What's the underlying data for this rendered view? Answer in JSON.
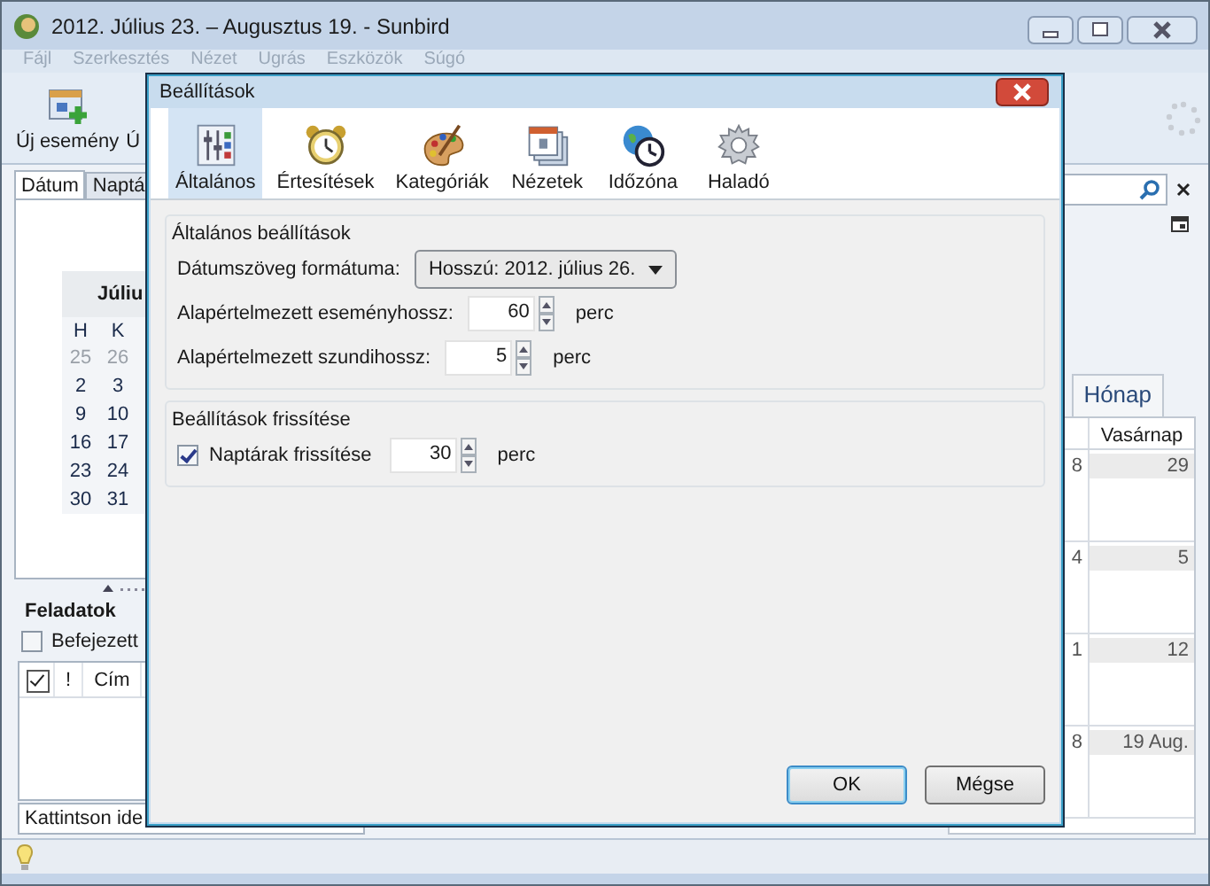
{
  "window": {
    "title": "2012. Július 23. – Augusztus 19. - Sunbird"
  },
  "menu": [
    {
      "label": "Fájl",
      "disabled": true
    },
    {
      "label": "Szerkesztés",
      "disabled": true
    },
    {
      "label": "Nézet",
      "disabled": true
    },
    {
      "label": "Ugrás",
      "disabled": true
    },
    {
      "label": "Eszközök",
      "disabled": true
    },
    {
      "label": "Súgó",
      "disabled": true
    }
  ],
  "toolbar": [
    {
      "label": "Új esemény",
      "kind": "event"
    },
    {
      "label": "Ú",
      "kind": "text"
    }
  ],
  "left_tabs": [
    {
      "label": "Dátum",
      "selected": true
    },
    {
      "label": "Naptá",
      "selected": false
    }
  ],
  "minimonth": {
    "title": "Júliu",
    "weekdays": [
      "H",
      "K"
    ],
    "weeks": [
      [
        {
          "text": "25",
          "outside": true
        },
        {
          "text": "26",
          "outside": true
        }
      ],
      [
        {
          "text": "2",
          "outside": false
        },
        {
          "text": "3",
          "outside": false
        }
      ],
      [
        {
          "text": "9",
          "outside": false
        },
        {
          "text": "10",
          "outside": false
        }
      ],
      [
        {
          "text": "16",
          "outside": false
        },
        {
          "text": "17",
          "outside": false
        }
      ],
      [
        {
          "text": "23",
          "outside": false
        },
        {
          "text": "24",
          "outside": false
        }
      ],
      [
        {
          "text": "30",
          "outside": false
        },
        {
          "text": "31",
          "outside": false
        }
      ]
    ]
  },
  "tasks": {
    "title": "Feladatok",
    "show_completed": {
      "label": "Befejezett",
      "checked": false
    },
    "columns": [
      {
        "kind": "check",
        "checked": true
      },
      {
        "kind": "text",
        "label": "!"
      },
      {
        "kind": "text",
        "label": "Cím"
      }
    ],
    "quick_add": "Kattintson ide"
  },
  "view_tabs": [
    {
      "label": "Hónap",
      "selected": true
    }
  ],
  "month": {
    "weekday": "Vasárnap",
    "weeks": [
      {
        "prev": "8",
        "day": "29"
      },
      {
        "prev": "4",
        "day": "5"
      },
      {
        "prev": "1",
        "day": "12"
      },
      {
        "prev": "8",
        "day": "19 Aug."
      }
    ]
  },
  "dialog": {
    "title": "Beállítások",
    "tabs": [
      {
        "label": "Általános",
        "selected": true
      },
      {
        "label": "Értesítések",
        "selected": false
      },
      {
        "label": "Kategóriák",
        "selected": false
      },
      {
        "label": "Nézetek",
        "selected": false
      },
      {
        "label": "Időzóna",
        "selected": false
      },
      {
        "label": "Haladó",
        "selected": false
      }
    ],
    "groups": [
      {
        "title": "Általános beállítások",
        "rows": [
          {
            "kind": "select",
            "label": "Dátumszöveg formátuma:",
            "value": "Hosszú: 2012. július 26."
          },
          {
            "kind": "number",
            "label": "Alapértelmezett eseményhossz:",
            "value": "60",
            "unit": "perc"
          },
          {
            "kind": "number",
            "label": "Alapértelmezett szundihossz:",
            "value": "5",
            "unit": "perc"
          }
        ]
      },
      {
        "title": "Beállítások frissítése",
        "rows": [
          {
            "kind": "check",
            "label": "Naptárak frissítése",
            "checked": true,
            "value": "30",
            "unit": "perc"
          }
        ]
      }
    ],
    "buttons": [
      {
        "label": "OK",
        "default": true
      },
      {
        "label": "Mégse",
        "default": false
      }
    ]
  }
}
